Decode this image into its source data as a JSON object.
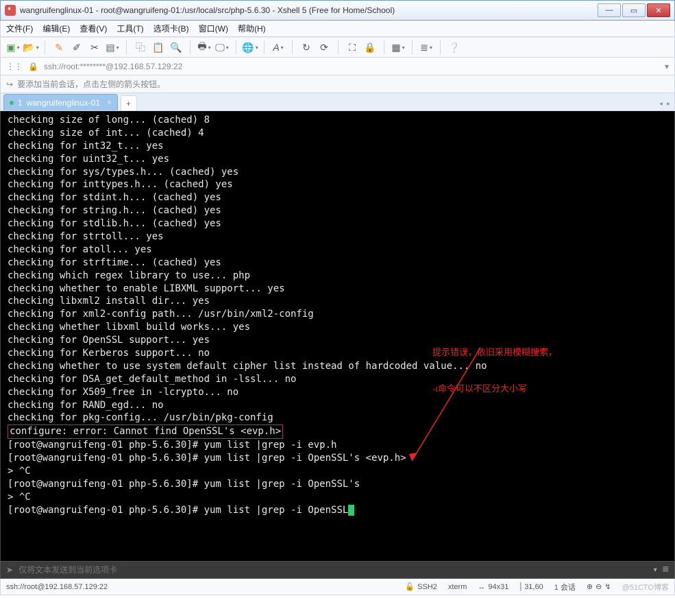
{
  "window": {
    "title": "wangruifenglinux-01 - root@wangruifeng-01:/usr/local/src/php-5.6.30 - Xshell 5 (Free for Home/School)"
  },
  "menu": {
    "file": "文件(F)",
    "edit": "编辑(E)",
    "view": "查看(V)",
    "tools": "工具(T)",
    "tabs": "选项卡(B)",
    "window": "窗口(W)",
    "help": "帮助(H)"
  },
  "address": {
    "value": "ssh://root:********@192.168.57.129:22"
  },
  "tip": {
    "text": "要添加当前会话，点击左侧的箭头按钮。"
  },
  "tab": {
    "index": "1",
    "label": "wangruifenglinux-01"
  },
  "terminal_lines": [
    "checking size of long... (cached) 8",
    "checking size of int... (cached) 4",
    "checking for int32_t... yes",
    "checking for uint32_t... yes",
    "checking for sys/types.h... (cached) yes",
    "checking for inttypes.h... (cached) yes",
    "checking for stdint.h... (cached) yes",
    "checking for string.h... (cached) yes",
    "checking for stdlib.h... (cached) yes",
    "checking for strtoll... yes",
    "checking for atoll... yes",
    "checking for strftime... (cached) yes",
    "checking which regex library to use... php",
    "checking whether to enable LIBXML support... yes",
    "checking libxml2 install dir... yes",
    "checking for xml2-config path... /usr/bin/xml2-config",
    "checking whether libxml build works... yes",
    "checking for OpenSSL support... yes",
    "checking for Kerberos support... no",
    "checking whether to use system default cipher list instead of hardcoded value... no",
    "checking for DSA_get_default_method in -lssl... no",
    "checking for X509_free in -lcrypto... no",
    "checking for RAND_egd... no",
    "checking for pkg-config... /usr/bin/pkg-config"
  ],
  "error_line": "configure: error: Cannot find OpenSSL's <evp.h>",
  "prompt_lines": {
    "p1_prefix": "[root@wangruifeng-01 php-5.6.30]# ",
    "p1_cmd": "yum list |grep -i evp.h",
    "p2_prefix": "[root@wangruifeng-01 php-5.6.30]# ",
    "p2_cmd": "yum list |grep -i OpenSSL's <evp.h>",
    "break1": "> ^C",
    "p3_prefix": "[root@wangruifeng-01 php-5.6.30]# ",
    "p3_cmd": "yum list |grep -i OpenSSL's",
    "break2": "> ^C",
    "p4_prefix": "[root@wangruifeng-01 php-5.6.30]# ",
    "p4_cmd": "yum list |grep -i OpenSSL"
  },
  "annotation": {
    "line1": "提示错误，依旧采用模糊搜索，",
    "line2": "-i命令可以不区分大小写"
  },
  "bottom_input": {
    "placeholder": "仅将文本发送到当前选项卡"
  },
  "status": {
    "conn": "ssh://root@192.168.57.129:22",
    "proto": "SSH2",
    "term": "xterm",
    "size": "94x31",
    "pos": "31,60",
    "sessions": "1 会话",
    "watermark": "@51CTO博客"
  }
}
